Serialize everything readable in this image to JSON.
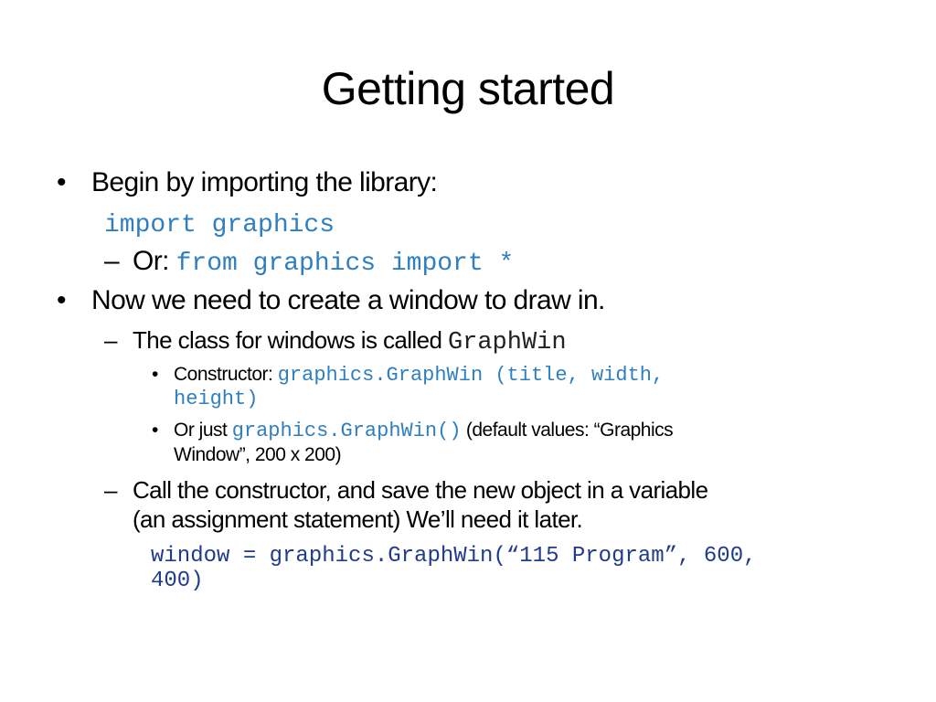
{
  "slide": {
    "title": "Getting started",
    "items": [
      {
        "bullet": "•",
        "text": "Begin by importing the library:"
      },
      {
        "code": "import graphics"
      },
      {
        "bullet": "–",
        "text": "Or: ",
        "code": "from graphics import *"
      },
      {
        "bullet": "•",
        "text": "Now we need to create a window to draw in."
      },
      {
        "bullet": "–",
        "text": "The class for windows is called ",
        "code": "GraphWin"
      },
      {
        "bullet": "•",
        "text": "Constructor: ",
        "code_line1": "graphics.GraphWin (title, width,",
        "code_line2": "height)"
      },
      {
        "bullet": "•",
        "text": "Or just ",
        "code": "graphics.GraphWin()",
        "text_after": " (default values: “Graphics",
        "text_line2": "Window”, 200 x 200)"
      },
      {
        "bullet": "–",
        "text_line1": "Call the constructor, and save the new object in a variable",
        "text_line2": "(an assignment statement) We’ll need it later."
      },
      {
        "code_line1": "window = graphics.GraphWin(“115 Program”, 600,",
        "code_line2": "400)"
      }
    ]
  }
}
